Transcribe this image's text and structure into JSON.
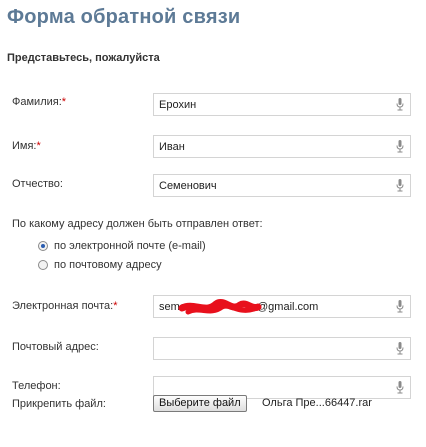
{
  "form": {
    "title": "Форма обратной связи",
    "subtitle": "Представьтесь, пожалуйста",
    "required_mark": "*",
    "fields": {
      "lastname": {
        "label": "Фамилия:",
        "value": "Ерохин",
        "required": true
      },
      "firstname": {
        "label": "Имя:",
        "value": "Иван",
        "required": true
      },
      "patronymic": {
        "label": "Отчество:",
        "value": "Семенович",
        "required": false
      },
      "email": {
        "label": "Электронная почта:",
        "value_start": "seme",
        "value_end": "@gmail.com",
        "required": true
      },
      "postal": {
        "label": "Почтовый адрес:",
        "value": "",
        "required": false
      },
      "phone": {
        "label": "Телефон:",
        "value": "",
        "required": false
      }
    },
    "reply_question": "По какому адресу должен быть отправлен ответ:",
    "reply_options": [
      {
        "label": "по электронной почте (e-mail)",
        "checked": true
      },
      {
        "label": "по почтовому адресу",
        "checked": false
      }
    ],
    "attach": {
      "label": "Прикрепить файл:",
      "button_label": "Выберите файл",
      "file_name": "Ольга Пре...66447.rar"
    }
  },
  "icons": {
    "voice_input": "microphone-icon"
  },
  "colors": {
    "title": "#5d7a96",
    "required": "#cc0000",
    "redaction": "#e8101c"
  }
}
